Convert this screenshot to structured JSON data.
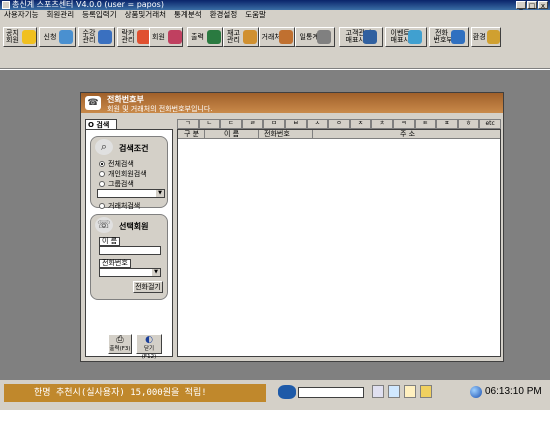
{
  "window": {
    "title": "총신계 스포츠센터 V4.0.0 (user = papos)",
    "controls": [
      "_",
      "□",
      "x"
    ]
  },
  "menu": [
    "사용자기능",
    "회원관리",
    "등록입력기",
    "상품및거래처",
    "통계분석",
    "환경설정",
    "도움말"
  ],
  "toolbar": [
    {
      "label": "공지\n회원",
      "icon": "bulb-icon",
      "color": "#f0c020"
    },
    {
      "label": "신청",
      "icon": "card-icon",
      "color": "#4a90d0"
    },
    {
      "label": "수강\n관리",
      "icon": "people-icon",
      "color": "#3a70c0"
    },
    {
      "label": "락커\n관리",
      "icon": "locker-icon",
      "color": "#e05030"
    },
    {
      "label": "회원",
      "icon": "members-icon",
      "color": "#c04060"
    },
    {
      "label": "출력",
      "icon": "globe-icon",
      "color": "#2a7a40"
    },
    {
      "label": "재고\n관리",
      "icon": "box-icon",
      "color": "#d09030"
    },
    {
      "label": "거래처",
      "icon": "folder-icon",
      "color": "#c07030"
    },
    {
      "label": "일통계",
      "icon": "chart-icon",
      "color": "#808080"
    },
    {
      "label": "고객관리\n매표시",
      "icon": "customer-icon",
      "color": "#3060a0"
    },
    {
      "label": "이벤트\n매표시",
      "icon": "event-icon",
      "color": "#40a0d0"
    },
    {
      "label": "전화\n번호부",
      "icon": "phone-icon",
      "color": "#3070c0"
    },
    {
      "label": "환경",
      "icon": "wrench-icon",
      "color": "#d0a030"
    }
  ],
  "panel": {
    "title": "전화번호부",
    "subtitle": "회원 및 거래처의 전화번호부입니다.",
    "left_tab": "O 검색",
    "search_group": {
      "title": "검색조건",
      "options": [
        "전체검색",
        "개인회원검색",
        "그룹검색"
      ],
      "selected": 0,
      "dropdown_value": "",
      "extra_option": "거래처검색"
    },
    "member_group": {
      "title": "선택회원",
      "name_label": "이 름",
      "name_value": "",
      "phone_label": "전화번호",
      "phone_value": "",
      "dial_button": "전화걸기"
    },
    "print_button": "출력(F3)",
    "close_button": "닫기(F12)",
    "tabs": [
      "ㄱ",
      "ㄴ",
      "ㄷ",
      "ㄹ",
      "ㅁ",
      "ㅂ",
      "ㅅ",
      "ㅇ",
      "ㅈ",
      "ㅊ",
      "ㅋ",
      "ㅌ",
      "ㅍ",
      "ㅎ",
      "etc"
    ],
    "columns": [
      "구 분",
      "이 름",
      "전화번호",
      "주 소"
    ]
  },
  "statusbar": {
    "ticker": "한명 추천시(실사용자) 15,000원을 적립!",
    "clock": "06:13:10 PM"
  }
}
